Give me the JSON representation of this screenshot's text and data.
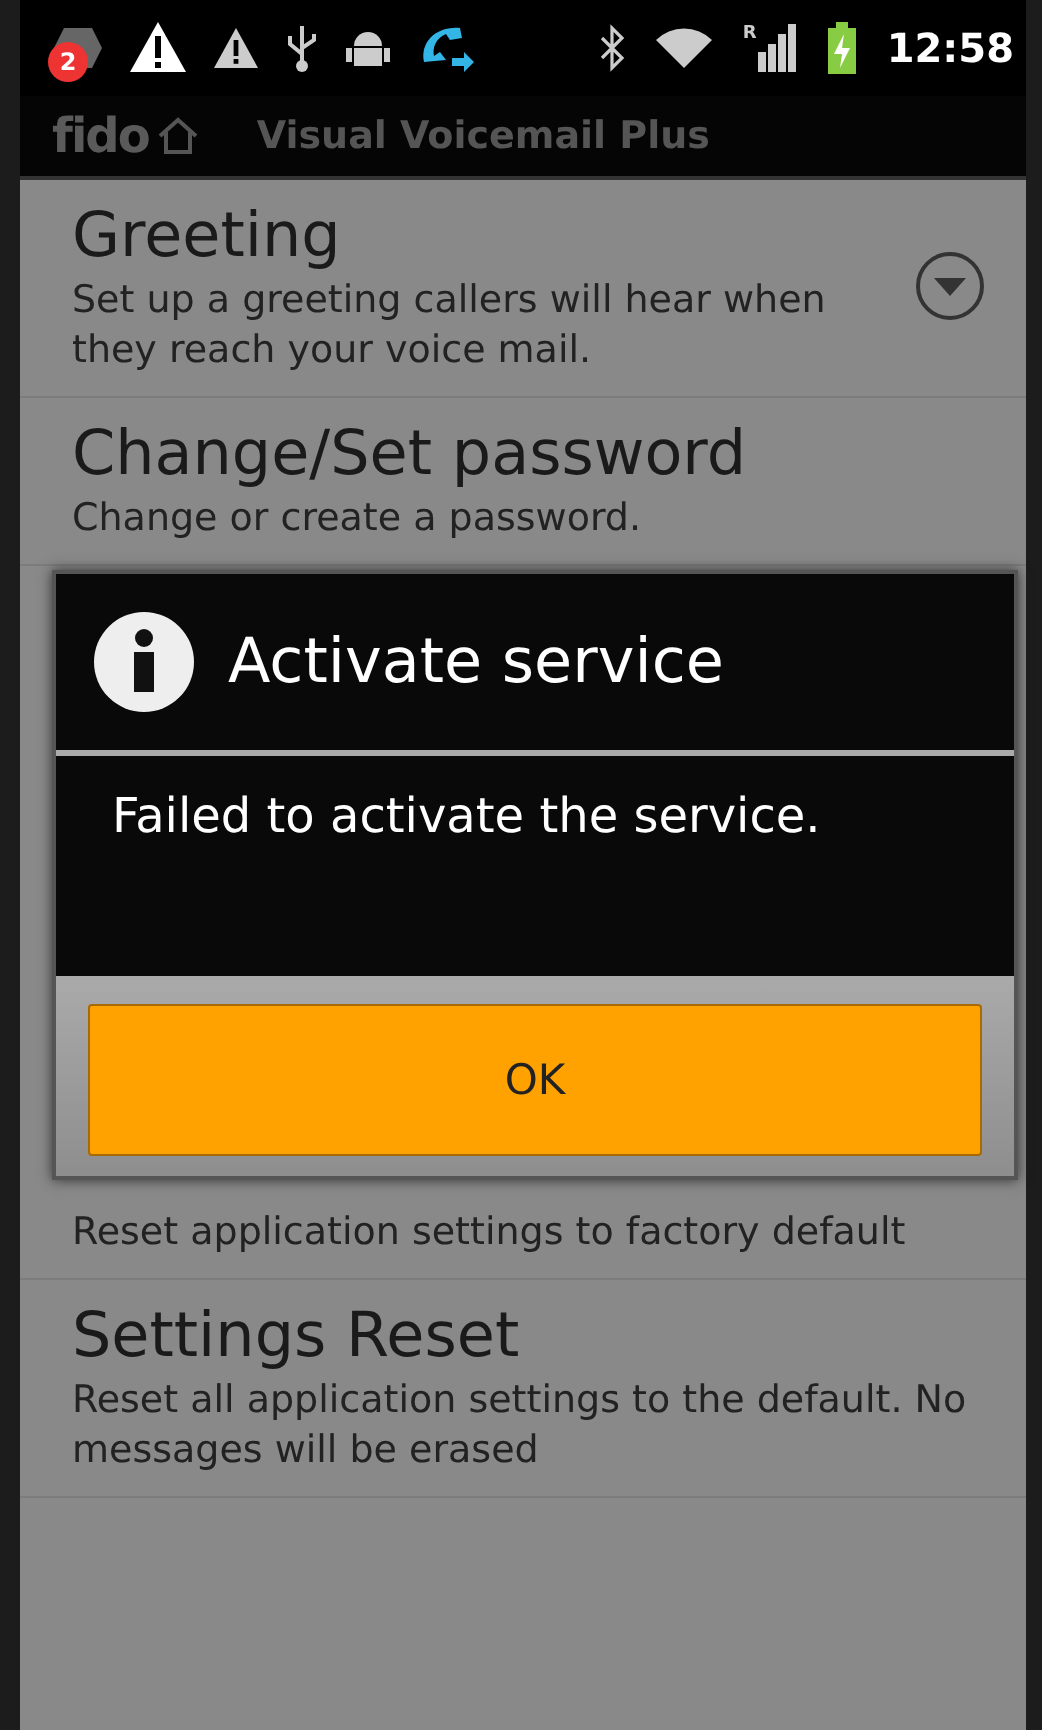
{
  "status_bar": {
    "notification_count": "2",
    "signal_roaming": "R",
    "time": "12:58"
  },
  "app_bar": {
    "logo": "fido",
    "title": "Visual Voicemail Plus"
  },
  "settings_top": [
    {
      "title": "Greeting",
      "description": "Set up a greeting callers will hear when they reach your voice mail.",
      "expandable": true
    },
    {
      "title": "Change/Set password",
      "description": "Change or create a password.",
      "expandable": false
    }
  ],
  "dialog": {
    "title": "Activate service",
    "message": "Failed to activate the service.",
    "buttons": [
      "OK"
    ]
  },
  "settings_bottom": [
    {
      "description": "Reset application settings to factory default",
      "expandable": false
    },
    {
      "title": "Settings Reset",
      "description": "Reset all application settings to the default. No messages will be erased",
      "expandable": false
    }
  ]
}
